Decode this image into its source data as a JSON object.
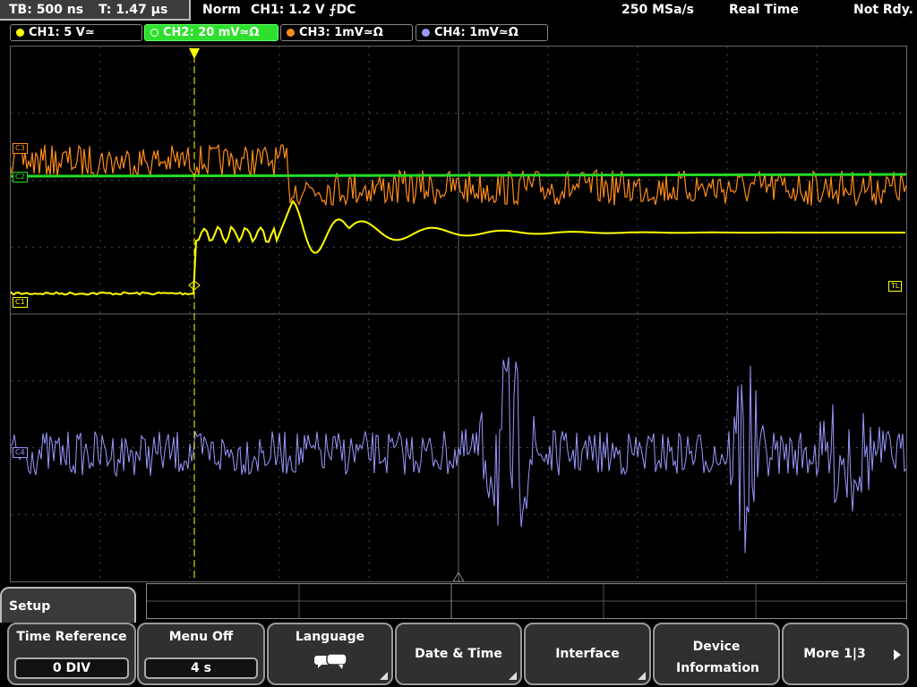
{
  "status_bar": {
    "timebase": "TB: 500 ns",
    "trigger_time": "T: 1.47 µs",
    "trigger_mode": "Norm",
    "trigger_info": "CH1: 1.2 V ⨍DC",
    "sample_rate": "250 MSa/s",
    "acquisition": "Real Time",
    "state": "Not Rdy."
  },
  "channels": [
    {
      "label": "CH1: 5 V≃",
      "color": "#ffff00",
      "active": false
    },
    {
      "label": "CH2: 20 mV≃Ω",
      "color": "#22dd22",
      "active": true
    },
    {
      "label": "CH3: 1mV≃Ω",
      "color": "#ff8c1a",
      "active": false
    },
    {
      "label": "CH4: 1mV≃Ω",
      "color": "#9999ff",
      "active": false
    }
  ],
  "markers": {
    "c3": "C3",
    "c2": "C2",
    "c1": "C1",
    "c4": "C4",
    "tl": "TL"
  },
  "menu": {
    "title": "Setup",
    "softkeys": [
      {
        "label": "Time Reference",
        "value": "0 DIV"
      },
      {
        "label": "Menu Off",
        "value": "4 s"
      },
      {
        "label": "Language",
        "icon": "speech-bubbles-icon"
      },
      {
        "label": "Date & Time"
      },
      {
        "label": "Interface"
      },
      {
        "label": "Device Information"
      },
      {
        "label": "More 1|3"
      }
    ]
  }
}
